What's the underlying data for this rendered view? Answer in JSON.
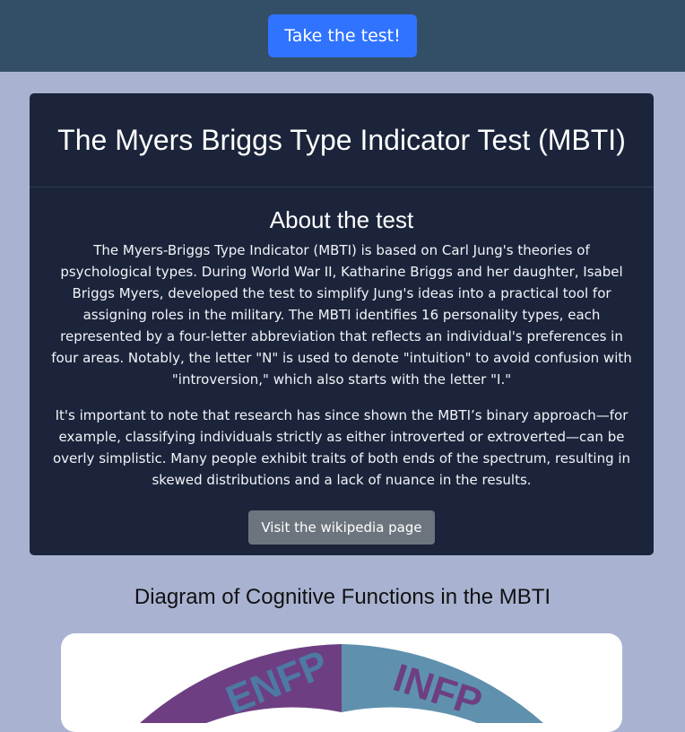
{
  "topbar": {
    "cta_label": "Take the test!"
  },
  "card": {
    "title": "The Myers Briggs Type Indicator Test (MBTI)",
    "section_title": "About the test",
    "paragraphs": [
      "The Myers-Briggs Type Indicator (MBTI) is based on Carl Jung's theories of psychological types. During World War II, Katharine Briggs and her daughter, Isabel Briggs Myers, developed the test to simplify Jung's ideas into a practical tool for assigning roles in the military. The MBTI identifies 16 personality types, each represented by a four-letter abbreviation that reflects an individual's preferences in four areas. Notably, the letter \"N\" is used to denote \"intuition\" to avoid confusion with \"introversion,\" which also starts with the letter \"I.\"",
      "It's important to note that research has since shown the MBTI’s binary approach—for example, classifying individuals strictly as either introverted or extroverted—can be overly simplistic. Many people exhibit traits of both ends of the spectrum, resulting in skewed distributions and a lack of nuance in the results."
    ],
    "wiki_button_label": "Visit the wikipedia page"
  },
  "diagram": {
    "title": "Diagram of Cognitive Functions in the MBTI",
    "labels": [
      "ENFP",
      "INFP"
    ],
    "colors": {
      "enfp": "#6d3f82",
      "infp": "#5f91af",
      "enfp_text": "#4d79a3",
      "infp_text": "#6d3f82"
    }
  },
  "colors": {
    "topbar_bg": "#334f67",
    "page_bg": "#a9b3d1",
    "card_bg": "#1b243a",
    "primary": "#2f73ff",
    "secondary": "#6c757d"
  }
}
